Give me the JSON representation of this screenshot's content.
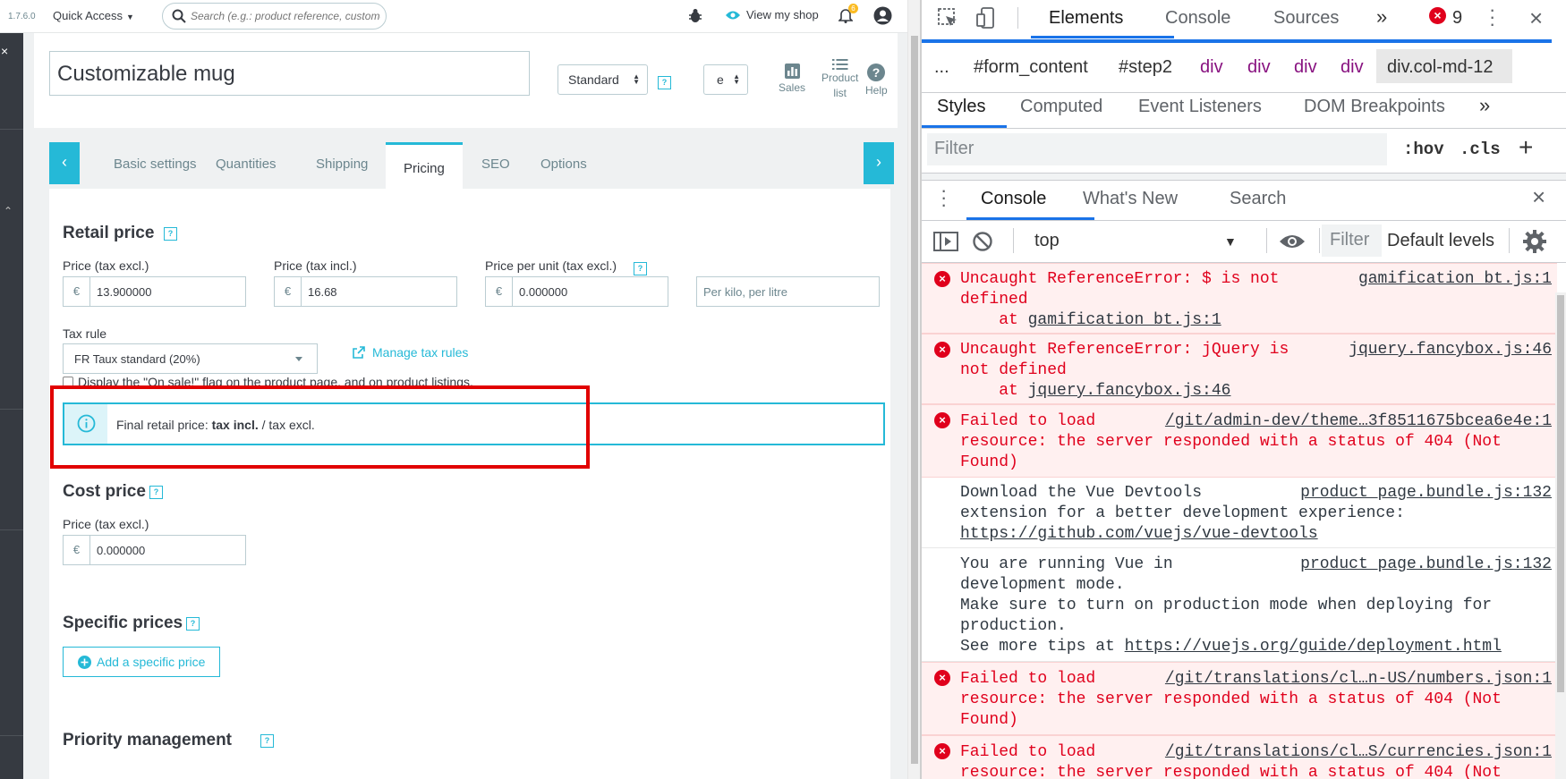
{
  "app": {
    "version": "1.7.6.0",
    "quick_access": "Quick Access",
    "search_placeholder": "Search (e.g.: product reference, custome",
    "view_shop": "View my shop",
    "notification_count": "6",
    "product_name": "Customizable mug",
    "product_type": "Standard",
    "lang_select": "e",
    "header_buttons": {
      "sales": "Sales",
      "product_list_1": "Product",
      "product_list_2": "list",
      "help": "Help"
    },
    "tabs": [
      "Basic settings",
      "Quantities",
      "Shipping",
      "Pricing",
      "SEO",
      "Options"
    ],
    "active_tab": "Pricing",
    "retail": {
      "heading": "Retail price",
      "price_excl_label": "Price (tax excl.)",
      "price_excl_value": "13.900000",
      "price_incl_label": "Price (tax incl.)",
      "price_incl_value": "16.68",
      "unit_label": "Price per unit (tax excl.)",
      "unit_value": "0.000000",
      "unit_placeholder": "Per kilo, per litre",
      "currency": "€",
      "tax_rule_label": "Tax rule",
      "tax_rule_value": "FR Taux standard (20%)",
      "manage_tax": "Manage tax rules",
      "on_sale_label": "Display the \"On sale!\" flag on the product page, and on product listings.",
      "final_prefix": "Final retail price: ",
      "final_bold": "tax incl.",
      "final_suffix": " / tax excl."
    },
    "cost": {
      "heading": "Cost price",
      "label": "Price (tax excl.)",
      "value": "0.000000"
    },
    "specific": {
      "heading": "Specific prices",
      "add_button": "Add a specific price"
    },
    "priority": {
      "heading": "Priority management"
    }
  },
  "devtools": {
    "tabs": [
      "Elements",
      "Console",
      "Sources"
    ],
    "more": "»",
    "error_count": "9",
    "breadcrumb": [
      "...",
      "#form_content",
      "#step2",
      "div",
      "div",
      "div",
      "div",
      "div.col-md-12"
    ],
    "style_tabs": [
      "Styles",
      "Computed",
      "Event Listeners",
      "DOM Breakpoints"
    ],
    "filter_placeholder": "Filter",
    "hov": ":hov",
    "cls": ".cls",
    "drawer_tabs": [
      "Console",
      "What's New",
      "Search"
    ],
    "context": "top",
    "console_filter": "Filter",
    "levels": "Default levels",
    "logs": [
      {
        "type": "error",
        "lines": [
          "Uncaught ReferenceError: $ is not",
          "defined"
        ],
        "at": "gamification_bt.js:1",
        "source": "gamification_bt.js:1"
      },
      {
        "type": "error",
        "lines": [
          "Uncaught ReferenceError: jQuery is",
          "not defined"
        ],
        "at": "jquery.fancybox.js:46",
        "source": "jquery.fancybox.js:46"
      },
      {
        "type": "error",
        "lines": [
          "Failed to load",
          "resource: the server responded with a status of 404 (Not",
          "Found)"
        ],
        "source": "/git/admin-dev/theme…3f8511675bcea6e4e:1"
      },
      {
        "type": "info",
        "lines": [
          "Download the Vue Devtools",
          "extension for a better development experience:"
        ],
        "link": "https://github.com/vuejs/vue-devtools",
        "source": "product_page.bundle.js:132"
      },
      {
        "type": "info",
        "lines": [
          "You are running Vue in",
          "development mode.",
          "Make sure to turn on production mode when deploying for",
          "production.",
          "See more tips at "
        ],
        "link": "https://vuejs.org/guide/deployment.html",
        "source": "product_page.bundle.js:132"
      },
      {
        "type": "error",
        "lines": [
          "Failed to load",
          "resource: the server responded with a status of 404 (Not",
          "Found)"
        ],
        "source": "/git/translations/cl…n-US/numbers.json:1"
      },
      {
        "type": "error",
        "lines": [
          "Failed to load",
          "resource: the server responded with a status of 404 (Not"
        ],
        "source": "/git/translations/cl…S/currencies.json:1"
      }
    ]
  },
  "colors": {
    "accent": "#25b9d7",
    "error": "#e0001c",
    "devtools_blue": "#1a73e8",
    "highlight": "#e10000"
  }
}
